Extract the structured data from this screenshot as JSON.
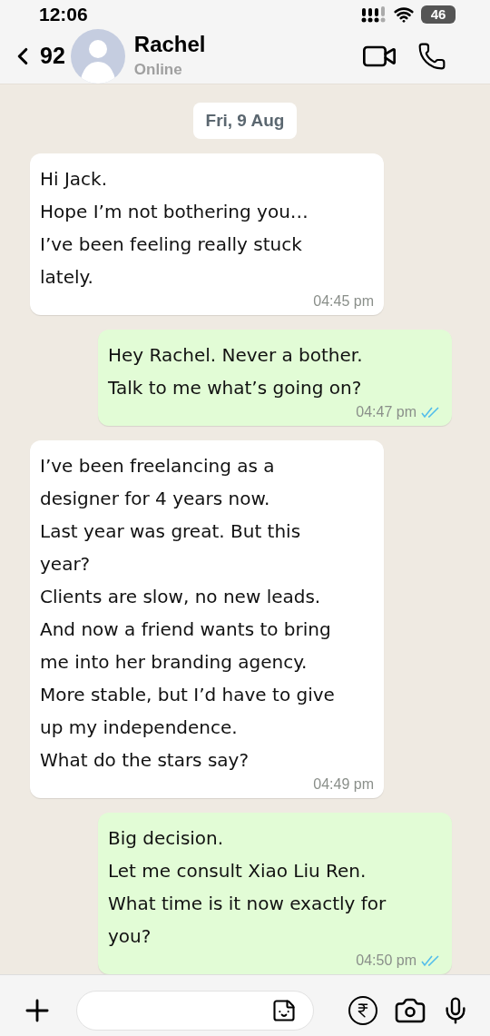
{
  "status_bar": {
    "time": "12:06",
    "battery": "46"
  },
  "header": {
    "back_count": "92",
    "name": "Rachel",
    "status": "Online"
  },
  "date_chip": "Fri, 9 Aug",
  "messages": [
    {
      "kind": "incoming",
      "lines": [
        "Hi Jack.",
        "Hope I’m not bothering you…",
        "I’ve been feeling really stuck lately."
      ],
      "time": "04:45 pm"
    },
    {
      "kind": "outgoing",
      "lines": [
        "Hey Rachel. Never a bother.",
        "Talk to me  what’s going on?"
      ],
      "time": "04:47 pm",
      "read": true
    },
    {
      "kind": "incoming",
      "lines": [
        "I’ve been freelancing as a designer for 4 years now.",
        "Last year was great. But this year?",
        "Clients are slow, no new leads.",
        "And now a friend wants to bring me into her branding agency.",
        "More stable, but I’d have to give up my independence.",
        "What do the stars say?"
      ],
      "time": "04:49 pm"
    },
    {
      "kind": "outgoing",
      "lines": [
        "Big decision.",
        "Let me consult Xiao Liu Ren.",
        "What time is it now exactly for you?"
      ],
      "time": "04:50 pm",
      "read": true
    }
  ]
}
